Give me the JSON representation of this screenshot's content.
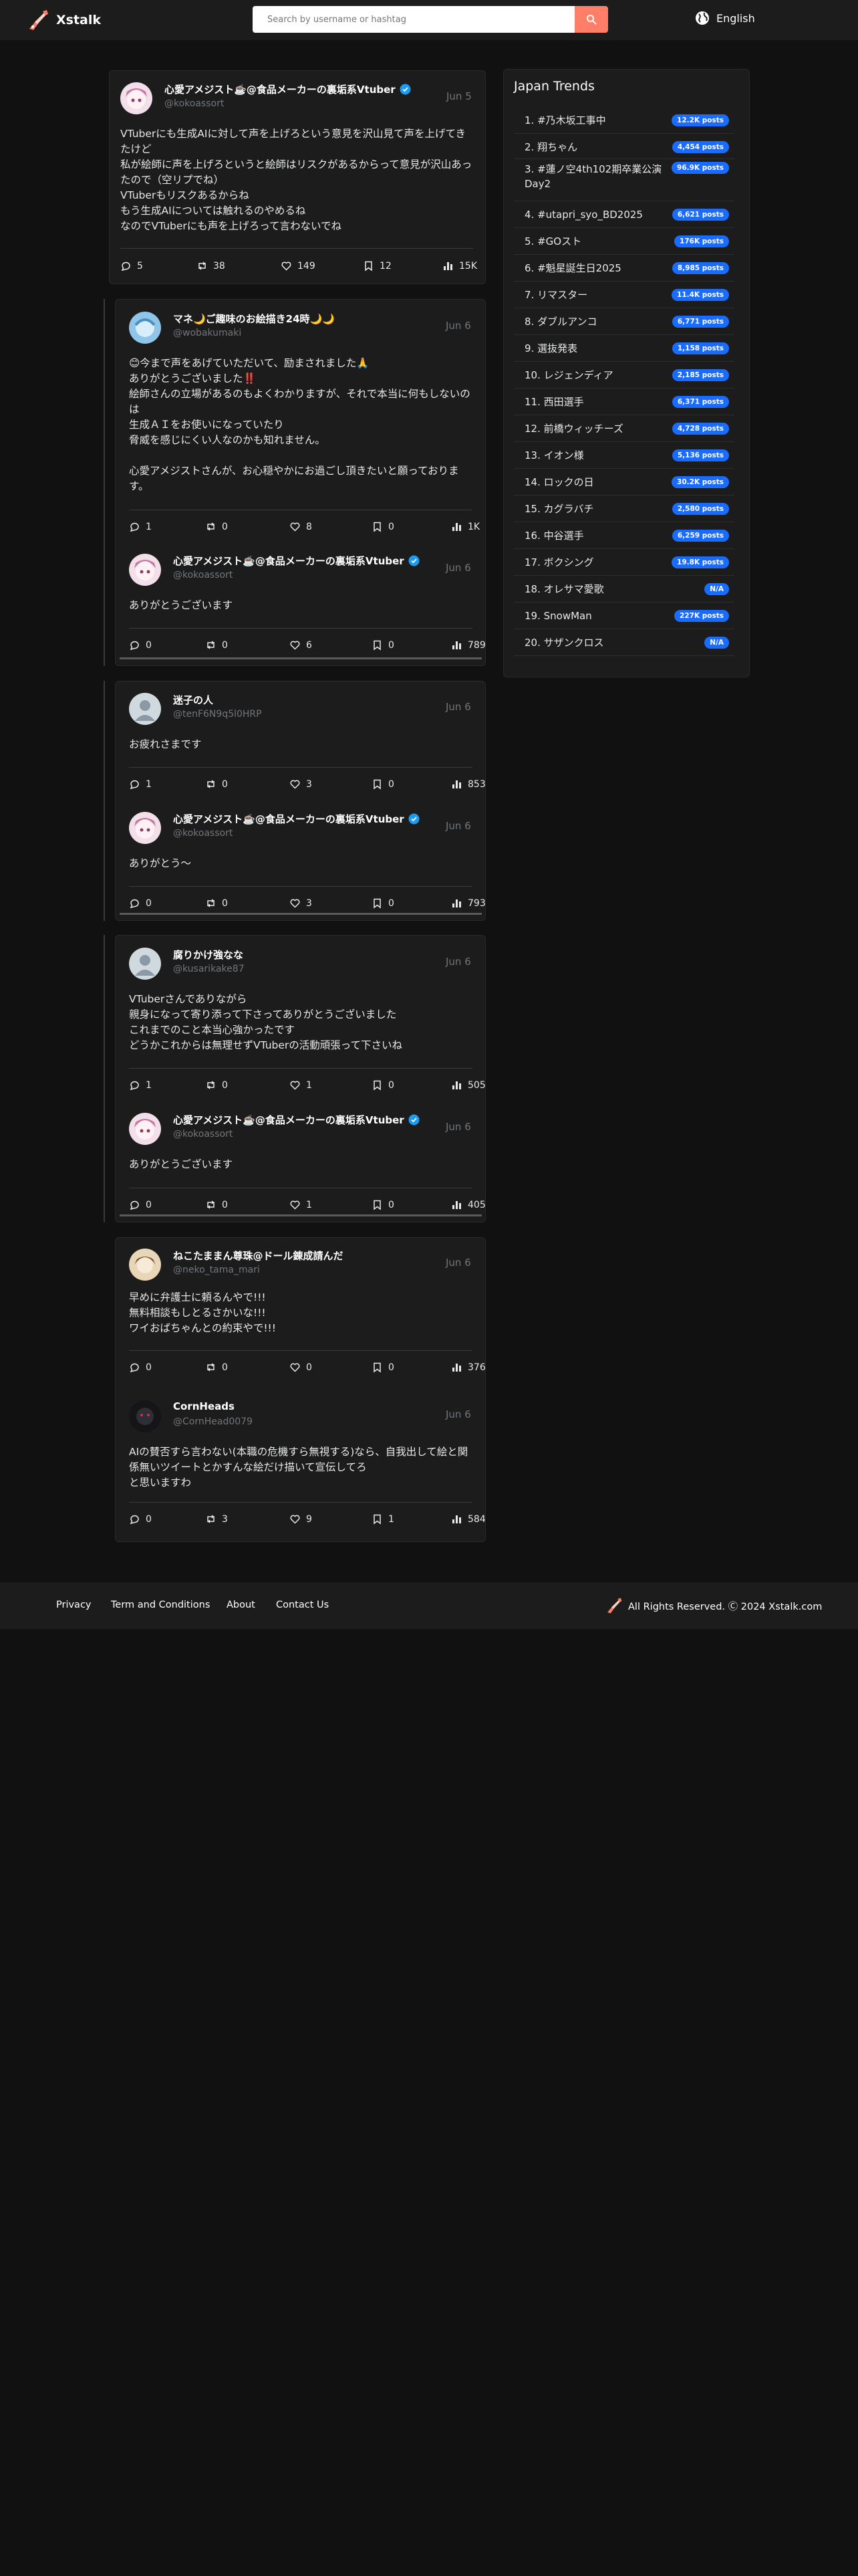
{
  "header": {
    "logo_text": "Xstalk",
    "search_placeholder": "Search by username or hashtag",
    "language": "English"
  },
  "posts": [
    {
      "name": "心愛アメジスト☕️@食品メーカーの裏垢系Vtuber",
      "handle": "@kokoassort",
      "date": "Jun 5",
      "text": "VTuberにも生成AIに対して声を上げろという意見を沢山見て声を上げてきたけど\n私が絵師に声を上げろというと絵師はリスクがあるからって意見が沢山あったので（空リプでね）\nVTuberもリスクあるからね\nもう生成AIについては触れるのやめるね\nなのでVTuberにも声を上げろって言わないでね",
      "stats": {
        "replies": "5",
        "reposts": "38",
        "likes": "149",
        "bookmarks": "12",
        "views": "15K"
      }
    },
    {
      "name": "マネ🌙ご趣味のお絵描き24時🌙🌙",
      "handle": "@wobakumaki",
      "date": "Jun 6",
      "text": "😊今まで声をあげていただいて、励まされました🙏\nありがとうございました‼️\n絵師さんの立場があるのもよくわかりますが、それで本当に何もしないのは\n生成ＡＩをお使いになっていたり\n脅威を感じにくい人なのかも知れません。\n\n心愛アメジストさんが、お心穏やかにお過ごし頂きたいと願っております。",
      "stats": {
        "replies": "1",
        "reposts": "0",
        "likes": "8",
        "bookmarks": "0",
        "views": "1K"
      }
    },
    {
      "name": "心愛アメジスト☕️@食品メーカーの裏垢系Vtuber",
      "handle": "@kokoassort",
      "date": "Jun 6",
      "text": "ありがとうございます",
      "stats": {
        "replies": "0",
        "reposts": "0",
        "likes": "6",
        "bookmarks": "0",
        "views": "789"
      }
    },
    {
      "name": "迷子の人",
      "handle": "@tenF6N9q5l0HRP",
      "date": "Jun 6",
      "text": "お疲れさまです",
      "stats": {
        "replies": "1",
        "reposts": "0",
        "likes": "3",
        "bookmarks": "0",
        "views": "853"
      }
    },
    {
      "name": "心愛アメジスト☕️@食品メーカーの裏垢系Vtuber",
      "handle": "@kokoassort",
      "date": "Jun 6",
      "text": "ありがとう〜",
      "stats": {
        "replies": "0",
        "reposts": "0",
        "likes": "3",
        "bookmarks": "0",
        "views": "793"
      }
    },
    {
      "name": "腐りかけ強なな",
      "handle": "@kusarikake87",
      "date": "Jun 6",
      "text": "VTuberさんでありながら\n親身になって寄り添って下さってありがとうございました\nこれまでのこと本当心強かったです\nどうかこれからは無理せずVTuberの活動頑張って下さいね",
      "stats": {
        "replies": "1",
        "reposts": "0",
        "likes": "1",
        "bookmarks": "0",
        "views": "505"
      }
    },
    {
      "name": "心愛アメジスト☕️@食品メーカーの裏垢系Vtuber",
      "handle": "@kokoassort",
      "date": "Jun 6",
      "text": "ありがとうございます",
      "stats": {
        "replies": "0",
        "reposts": "0",
        "likes": "1",
        "bookmarks": "0",
        "views": "405"
      }
    },
    {
      "name": "ねこたままん尊珠@ドール錬成請んだ",
      "handle": "@neko_tama_mari",
      "date": "Jun 6",
      "text": "早めに弁護士に頼るんやで!!!\n無料相談もしとるさかいな!!!\nワイおばちゃんとの約束やで!!!",
      "stats": {
        "replies": "0",
        "reposts": "0",
        "likes": "0",
        "bookmarks": "0",
        "views": "376"
      }
    },
    {
      "name": "CornHeads",
      "handle": "@CornHead0079",
      "date": "Jun 6",
      "text": "AIの賛否すら言わない(本職の危機すら無視する)なら、自我出して絵と関係無いツイートとかすんな絵だけ描いて宣伝してろ\nと思いますわ",
      "stats": {
        "replies": "0",
        "reposts": "3",
        "likes": "9",
        "bookmarks": "1",
        "views": "584"
      }
    }
  ],
  "trends": {
    "title": "Japan Trends",
    "items": [
      {
        "label": "1. #乃木坂工事中",
        "count": "12.2K posts"
      },
      {
        "label": "2. 翔ちゃん",
        "count": "4,454 posts"
      },
      {
        "label": "3. #蓮ノ空4th102期卒業公演Day2",
        "count": "96.9K posts"
      },
      {
        "label": "4. #utapri_syo_BD2025",
        "count": "6,621 posts"
      },
      {
        "label": "5. #GOスト",
        "count": "176K posts"
      },
      {
        "label": "6. #魁星誕生日2025",
        "count": "8,985 posts"
      },
      {
        "label": "7. リマスター",
        "count": "11.4K posts"
      },
      {
        "label": "8. ダブルアンコ",
        "count": "6,771 posts"
      },
      {
        "label": "9. 選抜発表",
        "count": "1,158 posts"
      },
      {
        "label": "10. レジェンディア",
        "count": "2,185 posts"
      },
      {
        "label": "11. 西田選手",
        "count": "6,371 posts"
      },
      {
        "label": "12. 前橋ウィッチーズ",
        "count": "4,728 posts"
      },
      {
        "label": "13. イオン様",
        "count": "5,136 posts"
      },
      {
        "label": "14. ロックの日",
        "count": "30.2K posts"
      },
      {
        "label": "15. カグラバチ",
        "count": "2,580 posts"
      },
      {
        "label": "16. 中谷選手",
        "count": "6,259 posts"
      },
      {
        "label": "17. ボクシング",
        "count": "19.8K posts"
      },
      {
        "label": "18. オレサマ愛歌",
        "count": "N/A"
      },
      {
        "label": "19. SnowMan",
        "count": "227K posts"
      },
      {
        "label": "20. サザンクロス",
        "count": "N/A"
      }
    ]
  },
  "footer": {
    "links": [
      "Privacy",
      "Term and Conditions",
      "About",
      "Contact Us"
    ],
    "copyright": "All Rights Reserved. Ⓒ 2024 Xstalk.com"
  },
  "colors": {
    "background": "#111111",
    "panel": "#1c1c1c",
    "accent": "#ff7e67",
    "badge": "#1a6cff",
    "verified": "#1d9bf0"
  }
}
